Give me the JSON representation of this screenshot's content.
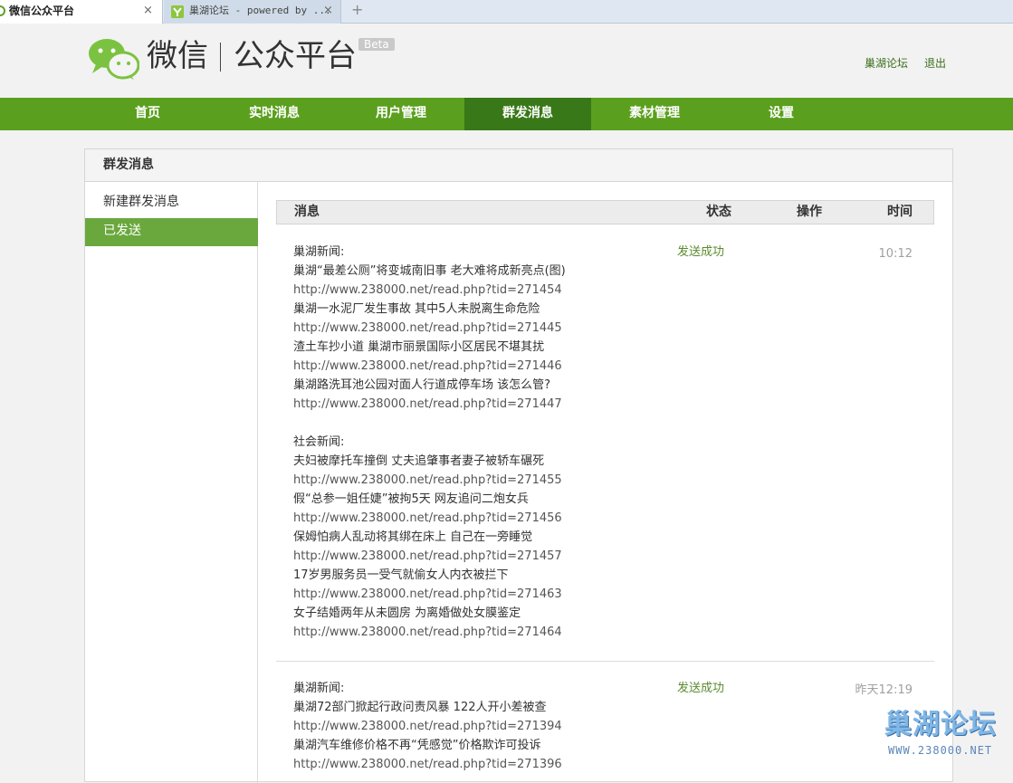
{
  "browser": {
    "tabs": [
      {
        "title": "微信公众平台",
        "close": "×"
      },
      {
        "title": "巢湖论坛 - powered by ...",
        "close": "×"
      }
    ],
    "new_tab": "+"
  },
  "header": {
    "brand_wx": "微信",
    "brand_mp": "公众平台",
    "beta": "Beta",
    "user_link": "巢湖论坛",
    "logout_link": "退出"
  },
  "nav": {
    "items": [
      "首页",
      "实时消息",
      "用户管理",
      "群发消息",
      "素材管理",
      "设置"
    ],
    "active": "群发消息"
  },
  "panel": {
    "title": "群发消息",
    "sidebar": [
      {
        "label": "新建群发消息",
        "active": false
      },
      {
        "label": "已发送",
        "active": true
      }
    ],
    "table_headers": {
      "message": "消息",
      "status": "状态",
      "action": "操作",
      "time": "时间"
    },
    "messages": [
      {
        "status": "发送成功",
        "time": "10:12",
        "lines": [
          "巢湖新闻:",
          "巢湖“最差公厕”将变城南旧事 老大难将成新亮点(图)",
          "http://www.238000.net/read.php?tid=271454",
          "巢湖一水泥厂发生事故 其中5人未脱离生命危险",
          "http://www.238000.net/read.php?tid=271445",
          "渣土车抄小道 巢湖市丽景国际小区居民不堪其扰",
          "http://www.238000.net/read.php?tid=271446",
          "巢湖路洗耳池公园对面人行道成停车场 该怎么管?",
          "http://www.238000.net/read.php?tid=271447",
          "",
          "社会新闻:",
          "夫妇被摩托车撞倒 丈夫追肇事者妻子被轿车碾死",
          "http://www.238000.net/read.php?tid=271455",
          "假“总参一姐任婕”被拘5天 网友追问二炮女兵",
          "http://www.238000.net/read.php?tid=271456",
          "保姆怕病人乱动将其绑在床上 自己在一旁睡觉",
          "http://www.238000.net/read.php?tid=271457",
          "17岁男服务员一受气就偷女人内衣被拦下",
          "http://www.238000.net/read.php?tid=271463",
          "女子结婚两年从未圆房 为离婚做处女膜鉴定",
          "http://www.238000.net/read.php?tid=271464"
        ]
      },
      {
        "status": "发送成功",
        "time": "昨天12:19",
        "lines": [
          "巢湖新闻:",
          "巢湖72部门掀起行政问责风暴 122人开小差被查",
          "http://www.238000.net/read.php?tid=271394",
          "巢湖汽车维修价格不再“凭感觉”价格欺诈可投诉",
          "http://www.238000.net/read.php?tid=271396"
        ]
      }
    ]
  },
  "watermark": {
    "big": "巢湖论坛",
    "small": "WWW.238000.NET"
  },
  "colors": {
    "nav_green": "#5b9f1e",
    "nav_active": "#397818",
    "side_active": "#6aa83e",
    "status_green": "#5b8a2e"
  }
}
